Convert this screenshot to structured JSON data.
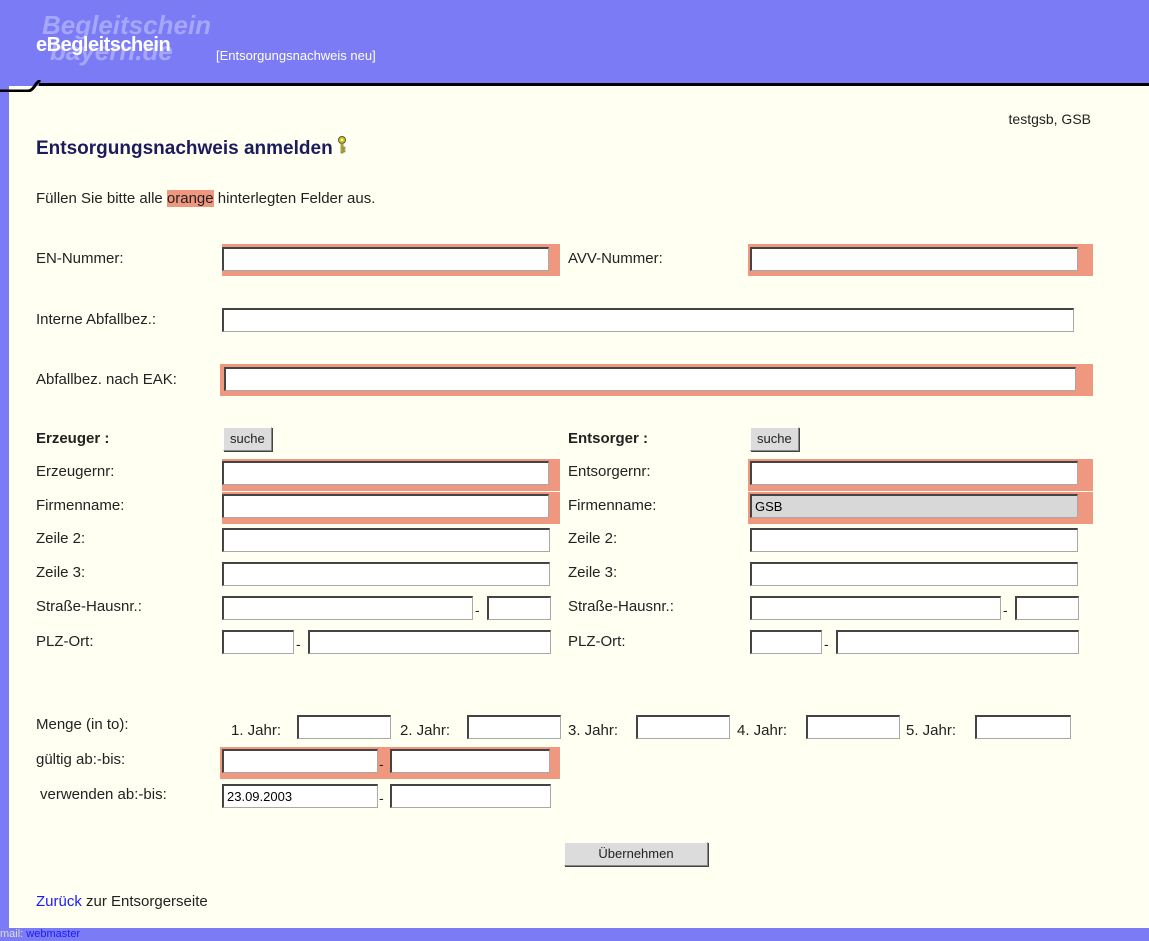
{
  "header": {
    "logo_shadow_1": "Begleitschein",
    "logo_shadow_2": "bayern.de",
    "logo": "eBegleitschein",
    "subtitle": "[Entsorgungsnachweis neu]"
  },
  "user": "testgsb, GSB",
  "title": "Entsorgungsnachweis anmelden",
  "intro": {
    "before": "Füllen Sie bitte alle ",
    "highlight": "orange",
    "after": " hinterlegten Felder aus."
  },
  "fields": {
    "en_nummer": "EN-Nummer:",
    "avv_nummer": "AVV-Nummer:",
    "interne_abfallbez": "Interne Abfallbez.:",
    "abfallbez_eak": "Abfallbez. nach EAK:"
  },
  "erzeuger": {
    "heading": "Erzeuger :",
    "search": "suche",
    "nr": "Erzeugernr:",
    "firma": "Firmenname:",
    "zeile2": "Zeile 2:",
    "zeile3": "Zeile 3:",
    "strasse": "Straße-Hausnr.:",
    "plz": "PLZ-Ort:"
  },
  "entsorger": {
    "heading": "Entsorger :",
    "search": "suche",
    "nr": "Entsorgernr:",
    "firma": "Firmenname:",
    "firma_value": "GSB",
    "zeile2": "Zeile 2:",
    "zeile3": "Zeile 3:",
    "strasse": "Straße-Hausnr.:",
    "plz": "PLZ-Ort:"
  },
  "menge": {
    "label": "Menge (in to):",
    "jahr1": "1. Jahr:",
    "jahr2": "2. Jahr:",
    "jahr3": "3. Jahr:",
    "jahr4": "4. Jahr:",
    "jahr5": "5. Jahr:"
  },
  "gueltig": "gültig ab:-bis:",
  "verwenden": "verwenden ab:-bis:",
  "verwenden_ab_value": "23.09.2003",
  "dash": "-",
  "submit": "Übernehmen",
  "back": {
    "link": "Zurück",
    "text": " zur Entsorgerseite"
  },
  "footer": {
    "prefix": "mail:",
    "link": "webmaster"
  },
  "colors": {
    "required": "#f0977f",
    "header": "#7b7bf5",
    "background": "#fffff2",
    "title": "#1b1b5e"
  }
}
